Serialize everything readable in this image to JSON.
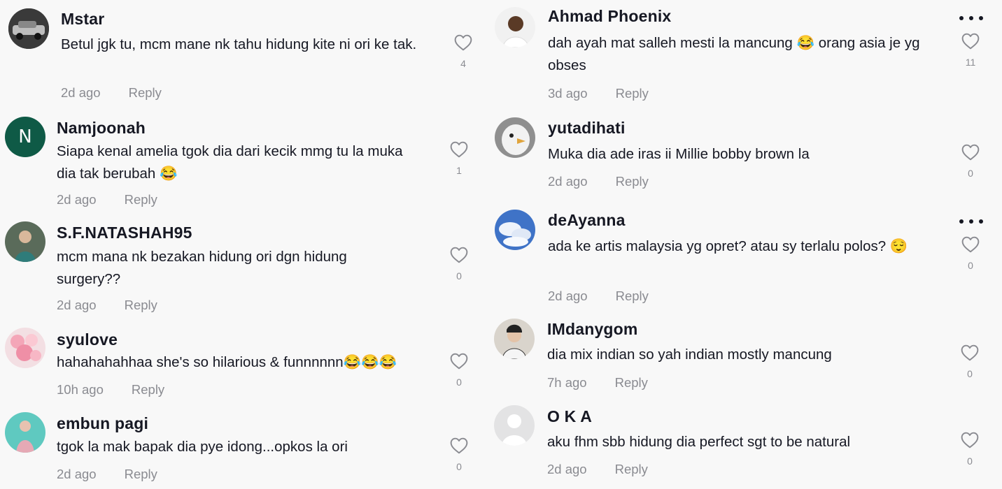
{
  "comments_left": [
    {
      "username": "Mstar",
      "text": "Betul jgk tu, mcm mane nk tahu hidung kite ni ori ke tak.",
      "time": "2d ago",
      "reply_label": "Reply",
      "likes": "4",
      "avatar": "car-photo"
    },
    {
      "username": "Namjoonah",
      "text": "Siapa kenal amelia tgok dia dari kecik mmg tu la muka dia tak berubah 😂",
      "time": "2d ago",
      "reply_label": "Reply",
      "likes": "1",
      "avatar_letter": "N"
    },
    {
      "username": "S.F.NATASHAH95",
      "text": "mcm mana nk bezakan hidung ori dgn hidung surgery??",
      "time": "2d ago",
      "reply_label": "Reply",
      "likes": "0",
      "avatar": "person-photo"
    },
    {
      "username": "syulove",
      "text": "hahahahahhaa she's so hilarious & funnnnnn😂😂😂",
      "time": "10h ago",
      "reply_label": "Reply",
      "likes": "0",
      "avatar": "flowers-photo"
    },
    {
      "username": "embun pagi",
      "text": "tgok la mak bapak dia pye idong...opkos la ori",
      "time": "2d ago",
      "reply_label": "Reply",
      "likes": "0",
      "avatar": "person-photo"
    }
  ],
  "comments_right": [
    {
      "username": "Ahmad Phoenix",
      "text": "dah ayah mat salleh mesti la mancung 😂 orang asia je yg obses",
      "time": "3d ago",
      "reply_label": "Reply",
      "likes": "11",
      "avatar": "person-photo"
    },
    {
      "username": "yutadihati",
      "text": "Muka dia ade iras ii Millie bobby brown la",
      "time": "2d ago",
      "reply_label": "Reply",
      "likes": "0",
      "avatar": "bird-photo"
    },
    {
      "username": "deAyanna",
      "text": "ada ke artis malaysia yg opret? atau sy terlalu polos? 😌",
      "time": "2d ago",
      "reply_label": "Reply",
      "likes": "0",
      "avatar": "sky-photo"
    },
    {
      "username": "IMdanygom",
      "text": "dia mix indian so yah indian mostly mancung",
      "time": "7h ago",
      "reply_label": "Reply",
      "likes": "0",
      "avatar": "person-photo"
    },
    {
      "username": "O K A",
      "text": "aku fhm sbb hidung dia perfect sgt to be natural",
      "time": "2d ago",
      "reply_label": "Reply",
      "likes": "0",
      "avatar": "default-avatar"
    }
  ],
  "colors": {
    "text": "#161823",
    "muted": "#8a8b91",
    "background": "#f8f8f8",
    "avatar_n": "#0f5a46"
  },
  "icons": {
    "like": "heart-outline-icon",
    "more": "more-options-icon"
  }
}
